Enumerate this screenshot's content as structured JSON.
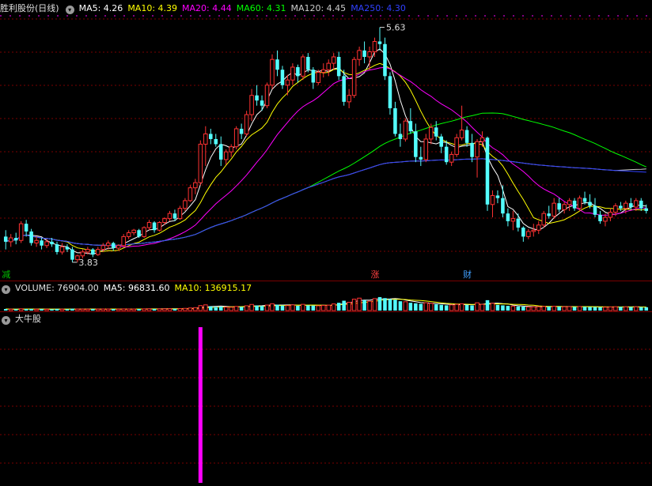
{
  "header": {
    "stock_name": "胜利股份(日线)",
    "ma": [
      {
        "label": "MA5: 4.26",
        "color": "#ffffff"
      },
      {
        "label": "MA10: 4.39",
        "color": "#ffff00"
      },
      {
        "label": "MA20: 4.44",
        "color": "#ff00ff"
      },
      {
        "label": "MA60: 4.31",
        "color": "#00ff00"
      },
      {
        "label": "MA120: 4.45",
        "color": "#cccccc"
      },
      {
        "label": "MA250: 4.30",
        "color": "#3040ff"
      }
    ]
  },
  "volume_header": {
    "title": "VOLUME: 76904.00",
    "ma5": "MA5: 96831.60",
    "ma10": "MA10: 136915.17"
  },
  "indicator_header": {
    "title": "大牛股"
  },
  "markers": [
    {
      "text": "减",
      "color": "#00c000",
      "index": 0
    },
    {
      "text": "涨",
      "color": "#ff4040",
      "index": 72
    },
    {
      "text": "财",
      "color": "#40a0ff",
      "index": 90
    }
  ],
  "colors": {
    "up": "#ff3232",
    "down": "#54ffff",
    "signal": "#ff00ff",
    "grid": "#7a0000"
  },
  "chart_data": {
    "type": "candlestick",
    "price_max_label": "5.63",
    "price_min_label": "3.83",
    "ylim": [
      3.75,
      5.72
    ],
    "ohlc": [
      [
        4.0,
        4.05,
        3.9,
        3.96
      ],
      [
        3.96,
        4.02,
        3.92,
        3.99
      ],
      [
        3.99,
        4.03,
        3.94,
        3.97
      ],
      [
        3.97,
        4.12,
        3.95,
        4.1
      ],
      [
        4.1,
        4.13,
        4.0,
        4.04
      ],
      [
        4.04,
        4.06,
        3.93,
        3.95
      ],
      [
        3.95,
        4.0,
        3.92,
        3.97
      ],
      [
        3.97,
        3.99,
        3.9,
        3.93
      ],
      [
        3.93,
        3.98,
        3.91,
        3.96
      ],
      [
        3.96,
        3.99,
        3.92,
        3.94
      ],
      [
        3.94,
        3.96,
        3.86,
        3.88
      ],
      [
        3.88,
        3.95,
        3.86,
        3.92
      ],
      [
        3.92,
        3.94,
        3.88,
        3.9
      ],
      [
        3.9,
        3.92,
        3.8,
        3.82
      ],
      [
        3.82,
        3.86,
        3.8,
        3.85
      ],
      [
        3.85,
        3.9,
        3.83,
        3.88
      ],
      [
        3.88,
        3.92,
        3.86,
        3.9
      ],
      [
        3.9,
        3.91,
        3.84,
        3.86
      ],
      [
        3.86,
        3.92,
        3.85,
        3.9
      ],
      [
        3.9,
        3.95,
        3.88,
        3.93
      ],
      [
        3.93,
        3.97,
        3.9,
        3.95
      ],
      [
        3.95,
        3.96,
        3.89,
        3.91
      ],
      [
        3.91,
        3.94,
        3.89,
        3.93
      ],
      [
        3.93,
        4.02,
        3.92,
        4.0
      ],
      [
        4.0,
        4.05,
        3.98,
        4.03
      ],
      [
        4.03,
        4.06,
        4.01,
        4.05
      ],
      [
        4.05,
        4.06,
        3.99,
        4.0
      ],
      [
        4.0,
        4.08,
        3.99,
        4.07
      ],
      [
        4.07,
        4.13,
        4.05,
        4.11
      ],
      [
        4.11,
        4.12,
        4.03,
        4.05
      ],
      [
        4.05,
        4.12,
        4.04,
        4.11
      ],
      [
        4.11,
        4.15,
        4.09,
        4.14
      ],
      [
        4.14,
        4.2,
        4.12,
        4.18
      ],
      [
        4.18,
        4.21,
        4.12,
        4.14
      ],
      [
        4.14,
        4.24,
        4.13,
        4.22
      ],
      [
        4.22,
        4.3,
        4.2,
        4.28
      ],
      [
        4.28,
        4.4,
        4.27,
        4.38
      ],
      [
        4.38,
        4.45,
        4.33,
        4.42
      ],
      [
        4.42,
        4.75,
        4.4,
        4.72
      ],
      [
        4.72,
        4.86,
        4.55,
        4.8
      ],
      [
        4.8,
        4.84,
        4.72,
        4.76
      ],
      [
        4.76,
        4.8,
        4.7,
        4.72
      ],
      [
        4.72,
        4.78,
        4.55,
        4.6
      ],
      [
        4.6,
        4.68,
        4.56,
        4.66
      ],
      [
        4.66,
        4.72,
        4.62,
        4.7
      ],
      [
        4.7,
        4.86,
        4.68,
        4.84
      ],
      [
        4.84,
        4.88,
        4.76,
        4.8
      ],
      [
        4.8,
        4.98,
        4.78,
        4.95
      ],
      [
        4.95,
        5.15,
        4.9,
        5.1
      ],
      [
        5.1,
        5.18,
        5.02,
        5.06
      ],
      [
        5.06,
        5.1,
        4.98,
        5.02
      ],
      [
        5.02,
        5.2,
        5.0,
        5.18
      ],
      [
        5.18,
        5.42,
        5.15,
        5.38
      ],
      [
        5.38,
        5.45,
        5.25,
        5.3
      ],
      [
        5.3,
        5.33,
        5.15,
        5.18
      ],
      [
        5.18,
        5.26,
        5.1,
        5.22
      ],
      [
        5.22,
        5.35,
        5.18,
        5.32
      ],
      [
        5.32,
        5.34,
        5.2,
        5.25
      ],
      [
        5.25,
        5.42,
        5.22,
        5.4
      ],
      [
        5.4,
        5.43,
        5.28,
        5.3
      ],
      [
        5.3,
        5.32,
        5.15,
        5.2
      ],
      [
        5.2,
        5.3,
        5.18,
        5.28
      ],
      [
        5.28,
        5.35,
        5.24,
        5.3
      ],
      [
        5.3,
        5.38,
        5.25,
        5.35
      ],
      [
        5.35,
        5.43,
        5.3,
        5.4
      ],
      [
        5.4,
        5.44,
        5.22,
        5.25
      ],
      [
        5.25,
        5.3,
        5.02,
        5.05
      ],
      [
        5.05,
        5.15,
        5.0,
        5.1
      ],
      [
        5.1,
        5.4,
        5.08,
        5.38
      ],
      [
        5.38,
        5.48,
        5.33,
        5.45
      ],
      [
        5.45,
        5.52,
        5.35,
        5.4
      ],
      [
        5.4,
        5.48,
        5.3,
        5.44
      ],
      [
        5.44,
        5.55,
        5.4,
        5.52
      ],
      [
        5.52,
        5.63,
        5.45,
        5.5
      ],
      [
        5.5,
        5.55,
        5.22,
        5.25
      ],
      [
        5.25,
        5.28,
        4.95,
        5.0
      ],
      [
        5.0,
        5.05,
        4.78,
        4.8
      ],
      [
        4.8,
        4.88,
        4.7,
        4.76
      ],
      [
        4.76,
        4.92,
        4.74,
        4.9
      ],
      [
        4.9,
        5.0,
        4.8,
        4.82
      ],
      [
        4.82,
        4.88,
        4.58,
        4.62
      ],
      [
        4.62,
        4.7,
        4.55,
        4.6
      ],
      [
        4.6,
        4.8,
        4.58,
        4.76
      ],
      [
        4.76,
        4.88,
        4.72,
        4.85
      ],
      [
        4.85,
        4.9,
        4.75,
        4.78
      ],
      [
        4.78,
        4.8,
        4.65,
        4.7
      ],
      [
        4.7,
        4.75,
        4.56,
        4.58
      ],
      [
        4.58,
        4.66,
        4.55,
        4.64
      ],
      [
        4.64,
        4.8,
        4.62,
        4.77
      ],
      [
        4.77,
        5.02,
        4.75,
        4.83
      ],
      [
        4.83,
        4.86,
        4.7,
        4.73
      ],
      [
        4.73,
        4.8,
        4.58,
        4.62
      ],
      [
        4.62,
        4.76,
        4.46,
        4.74
      ],
      [
        4.74,
        4.82,
        4.7,
        4.77
      ],
      [
        4.77,
        4.78,
        4.2,
        4.25
      ],
      [
        4.25,
        4.36,
        4.15,
        4.32
      ],
      [
        4.32,
        4.36,
        4.26,
        4.3
      ],
      [
        4.3,
        4.4,
        4.15,
        4.18
      ],
      [
        4.18,
        4.22,
        4.08,
        4.12
      ],
      [
        4.12,
        4.2,
        4.05,
        4.14
      ],
      [
        4.14,
        4.18,
        4.04,
        4.07
      ],
      [
        4.07,
        4.08,
        3.96,
        4.0
      ],
      [
        4.0,
        4.06,
        3.98,
        4.04
      ],
      [
        4.04,
        4.1,
        4.0,
        4.05
      ],
      [
        4.05,
        4.12,
        4.02,
        4.09
      ],
      [
        4.09,
        4.2,
        4.07,
        4.18
      ],
      [
        4.18,
        4.24,
        4.14,
        4.16
      ],
      [
        4.16,
        4.3,
        4.14,
        4.26
      ],
      [
        4.26,
        4.3,
        4.19,
        4.21
      ],
      [
        4.21,
        4.27,
        4.18,
        4.25
      ],
      [
        4.25,
        4.3,
        4.2,
        4.28
      ],
      [
        4.28,
        4.3,
        4.2,
        4.22
      ],
      [
        4.22,
        4.32,
        4.2,
        4.3
      ],
      [
        4.3,
        4.35,
        4.25,
        4.27
      ],
      [
        4.27,
        4.33,
        4.22,
        4.24
      ],
      [
        4.24,
        4.3,
        4.15,
        4.17
      ],
      [
        4.17,
        4.2,
        4.1,
        4.12
      ],
      [
        4.12,
        4.18,
        4.08,
        4.15
      ],
      [
        4.15,
        4.22,
        4.12,
        4.19
      ],
      [
        4.19,
        4.26,
        4.16,
        4.24
      ],
      [
        4.24,
        4.27,
        4.2,
        4.22
      ],
      [
        4.22,
        4.28,
        4.18,
        4.26
      ],
      [
        4.26,
        4.3,
        4.21,
        4.23
      ],
      [
        4.23,
        4.3,
        4.2,
        4.28
      ],
      [
        4.28,
        4.3,
        4.2,
        4.22
      ],
      [
        4.22,
        4.25,
        4.18,
        4.2
      ]
    ],
    "volume_ylim": [
      0,
      320000
    ],
    "volume": [
      30000,
      28000,
      26000,
      34000,
      30000,
      32000,
      27000,
      29000,
      26000,
      25000,
      33000,
      28000,
      27000,
      36000,
      30000,
      29000,
      28000,
      30000,
      29000,
      31000,
      30000,
      29000,
      28000,
      32000,
      31000,
      30000,
      30000,
      33000,
      34000,
      31000,
      33000,
      34000,
      36000,
      33000,
      38000,
      42000,
      50000,
      56000,
      96000,
      110000,
      80000,
      70000,
      76000,
      66000,
      64000,
      80000,
      70000,
      92000,
      118000,
      96000,
      88000,
      106000,
      132000,
      112000,
      98000,
      96000,
      110000,
      92000,
      120000,
      100000,
      96000,
      92000,
      100000,
      104000,
      128000,
      150000,
      190000,
      160000,
      220000,
      240000,
      200000,
      180000,
      230000,
      260000,
      240000,
      220000,
      210000,
      180000,
      170000,
      150000,
      140000,
      130000,
      150000,
      140000,
      120000,
      110000,
      100000,
      110000,
      120000,
      130000,
      110000,
      100000,
      150000,
      120000,
      200000,
      140000,
      110000,
      100000,
      90000,
      86000,
      80000,
      76000,
      70000,
      72000,
      74000,
      80000,
      78000,
      84000,
      76000,
      74000,
      76000,
      70000,
      78000,
      72000,
      70000,
      68000,
      64000,
      66000,
      70000,
      74000,
      70000,
      72000,
      68000,
      72000,
      66000,
      64000
    ],
    "signal_index": 38
  }
}
